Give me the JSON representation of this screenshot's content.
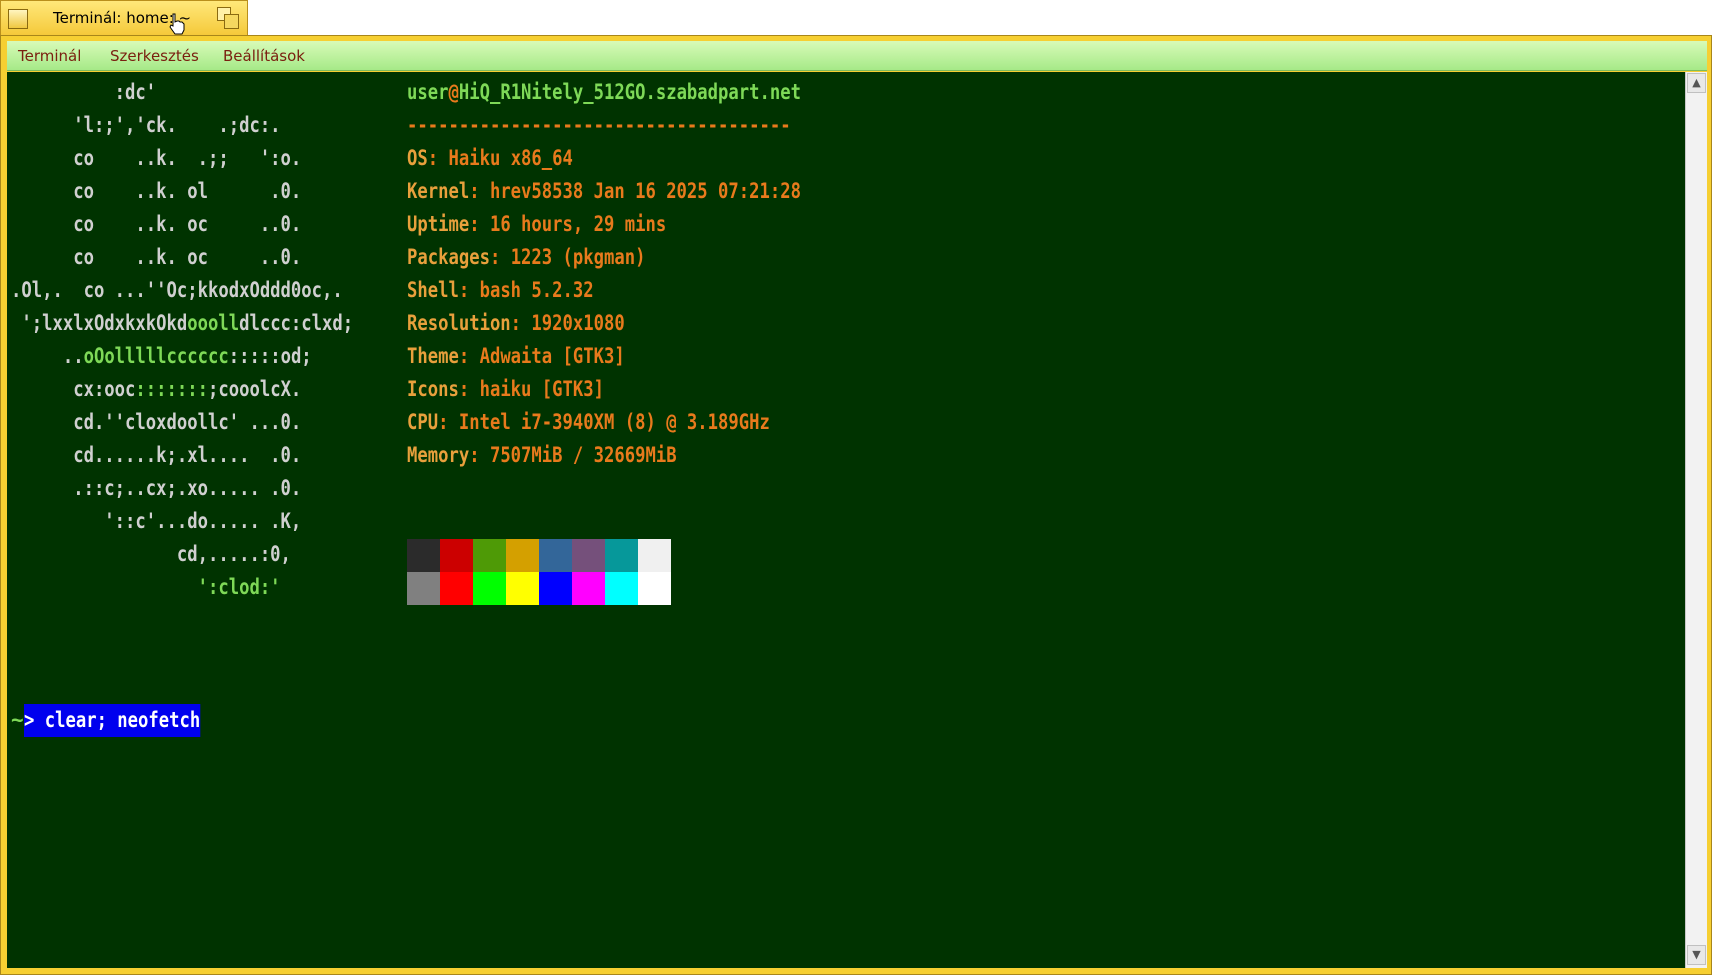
{
  "tab": {
    "title": "Terminál: home: ~"
  },
  "menu": [
    "Terminál",
    "Szerkesztés",
    "Beállítások"
  ],
  "logo": [
    [
      {
        "t": "          :dc'",
        "c": ""
      }
    ],
    [
      {
        "t": "      'l:;','ck.    .;dc:.",
        "c": ""
      }
    ],
    [
      {
        "t": "      co    ..k.  .;;   ':o.",
        "c": ""
      }
    ],
    [
      {
        "t": "      co    ..k. ol      .0.",
        "c": ""
      }
    ],
    [
      {
        "t": "      co    ..k. oc     ..0.",
        "c": ""
      }
    ],
    [
      {
        "t": "      co    ..k. oc     ..0.",
        "c": ""
      }
    ],
    [
      {
        "t": ".Ol,.  co ...''Oc;kkodxOddd0oc,.",
        "c": ""
      }
    ],
    [
      {
        "t": " ';lxxlxOdxkxkOkd",
        "c": ""
      },
      {
        "t": "oooll",
        "c": "g"
      },
      {
        "t": "dlccc:clxd;",
        "c": ""
      }
    ],
    [
      {
        "t": "     ..",
        "c": ""
      },
      {
        "t": "oOolllllcccccc",
        "c": "g"
      },
      {
        "t": ":::::od;",
        "c": ""
      }
    ],
    [
      {
        "t": "      cx:ooc",
        "c": ""
      },
      {
        "t": ":::::::",
        "c": "g"
      },
      {
        "t": ";cooolcX.",
        "c": ""
      }
    ],
    [
      {
        "t": "      cd.''cloxdoollc' ...0.",
        "c": ""
      }
    ],
    [
      {
        "t": "      cd......k;.xl....  .0.",
        "c": ""
      }
    ],
    [
      {
        "t": "      .::c;..cx;.xo..... .0.",
        "c": ""
      }
    ],
    [
      {
        "t": "         '::c'...do..... .K,",
        "c": ""
      }
    ],
    [
      {
        "t": "                cd,.....:0,",
        "c": ""
      }
    ],
    [
      {
        "t": "                  ':clod:'",
        "c": "g"
      }
    ]
  ],
  "title_line": {
    "user": "user",
    "at": "@",
    "host": "HiQ_R1Nitely_512GO.szabadpart.net"
  },
  "separator": "-------------------------------------",
  "info": [
    {
      "label": "OS",
      "value": "Haiku x86_64"
    },
    {
      "label": "Kernel",
      "value": "hrev58538 Jan 16 2025 07:21:28"
    },
    {
      "label": "Uptime",
      "value": "16 hours, 29 mins"
    },
    {
      "label": "Packages",
      "value": "1223 (pkgman)"
    },
    {
      "label": "Shell",
      "value": "bash 5.2.32"
    },
    {
      "label": "Resolution",
      "value": "1920x1080"
    },
    {
      "label": "Theme",
      "value": "Adwaita [GTK3]"
    },
    {
      "label": "Icons",
      "value": "haiku [GTK3]"
    },
    {
      "label": "CPU",
      "value": "Intel i7-3940XM (8) @ 3.189GHz"
    },
    {
      "label": "Memory",
      "value": "7507MiB / 32669MiB"
    }
  ],
  "palette": {
    "normal": [
      "#2b2b2b",
      "#cc0000",
      "#4e9a06",
      "#d4a000",
      "#336699",
      "#75507b",
      "#06989a",
      "#f0f0f0"
    ],
    "bright": [
      "#808080",
      "#ff0000",
      "#00ff00",
      "#ffff00",
      "#0000ff",
      "#ff00ff",
      "#00ffff",
      "#ffffff"
    ]
  },
  "prompt": {
    "tilde": "~",
    "command": "> clear; neofetch"
  },
  "colors": {
    "terminal_bg": "#003300",
    "window_frame": "#f6cf32",
    "menubar": "#b8f09a"
  }
}
